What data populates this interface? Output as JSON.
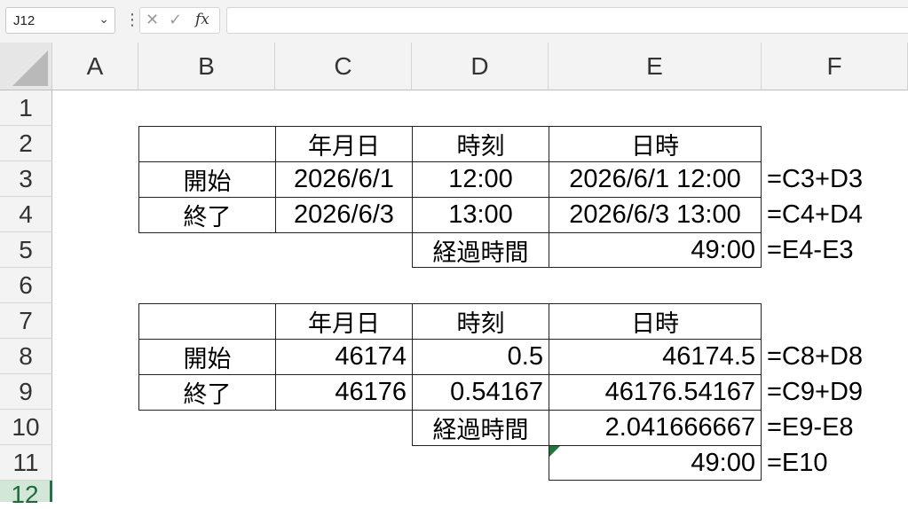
{
  "toolbar": {
    "namebox_value": "J12",
    "formula_value": ""
  },
  "columns": [
    "A",
    "B",
    "C",
    "D",
    "E",
    "F"
  ],
  "rows": [
    "1",
    "2",
    "3",
    "4",
    "5",
    "6",
    "7",
    "8",
    "9",
    "10",
    "11",
    "12"
  ],
  "cells": {
    "C2": "年月日",
    "D2": "時刻",
    "E2": "日時",
    "B3": "開始",
    "C3": "2026/6/1",
    "D3": "12:00",
    "E3": "2026/6/1 12:00",
    "F3": "=C3+D3",
    "B4": "終了",
    "C4": "2026/6/3",
    "D4": "13:00",
    "E4": "2026/6/3 13:00",
    "F4": "=C4+D4",
    "D5": "経過時間",
    "E5": "49:00",
    "F5": "=E4-E3",
    "C7": "年月日",
    "D7": "時刻",
    "E7": "日時",
    "B8": "開始",
    "C8": "46174",
    "D8": "0.5",
    "E8": "46174.5",
    "F8": "=C8+D8",
    "B9": "終了",
    "C9": "46176",
    "D9": "0.54167",
    "E9": "46176.54167",
    "F9": "=C9+D9",
    "D10": "経過時間",
    "E10": "2.041666667",
    "F10": "=E9-E8",
    "E11": "49:00",
    "F11": "=E10"
  },
  "colors": {
    "selected_row_header": "#217346",
    "error_indicator": "#1b7a36"
  }
}
